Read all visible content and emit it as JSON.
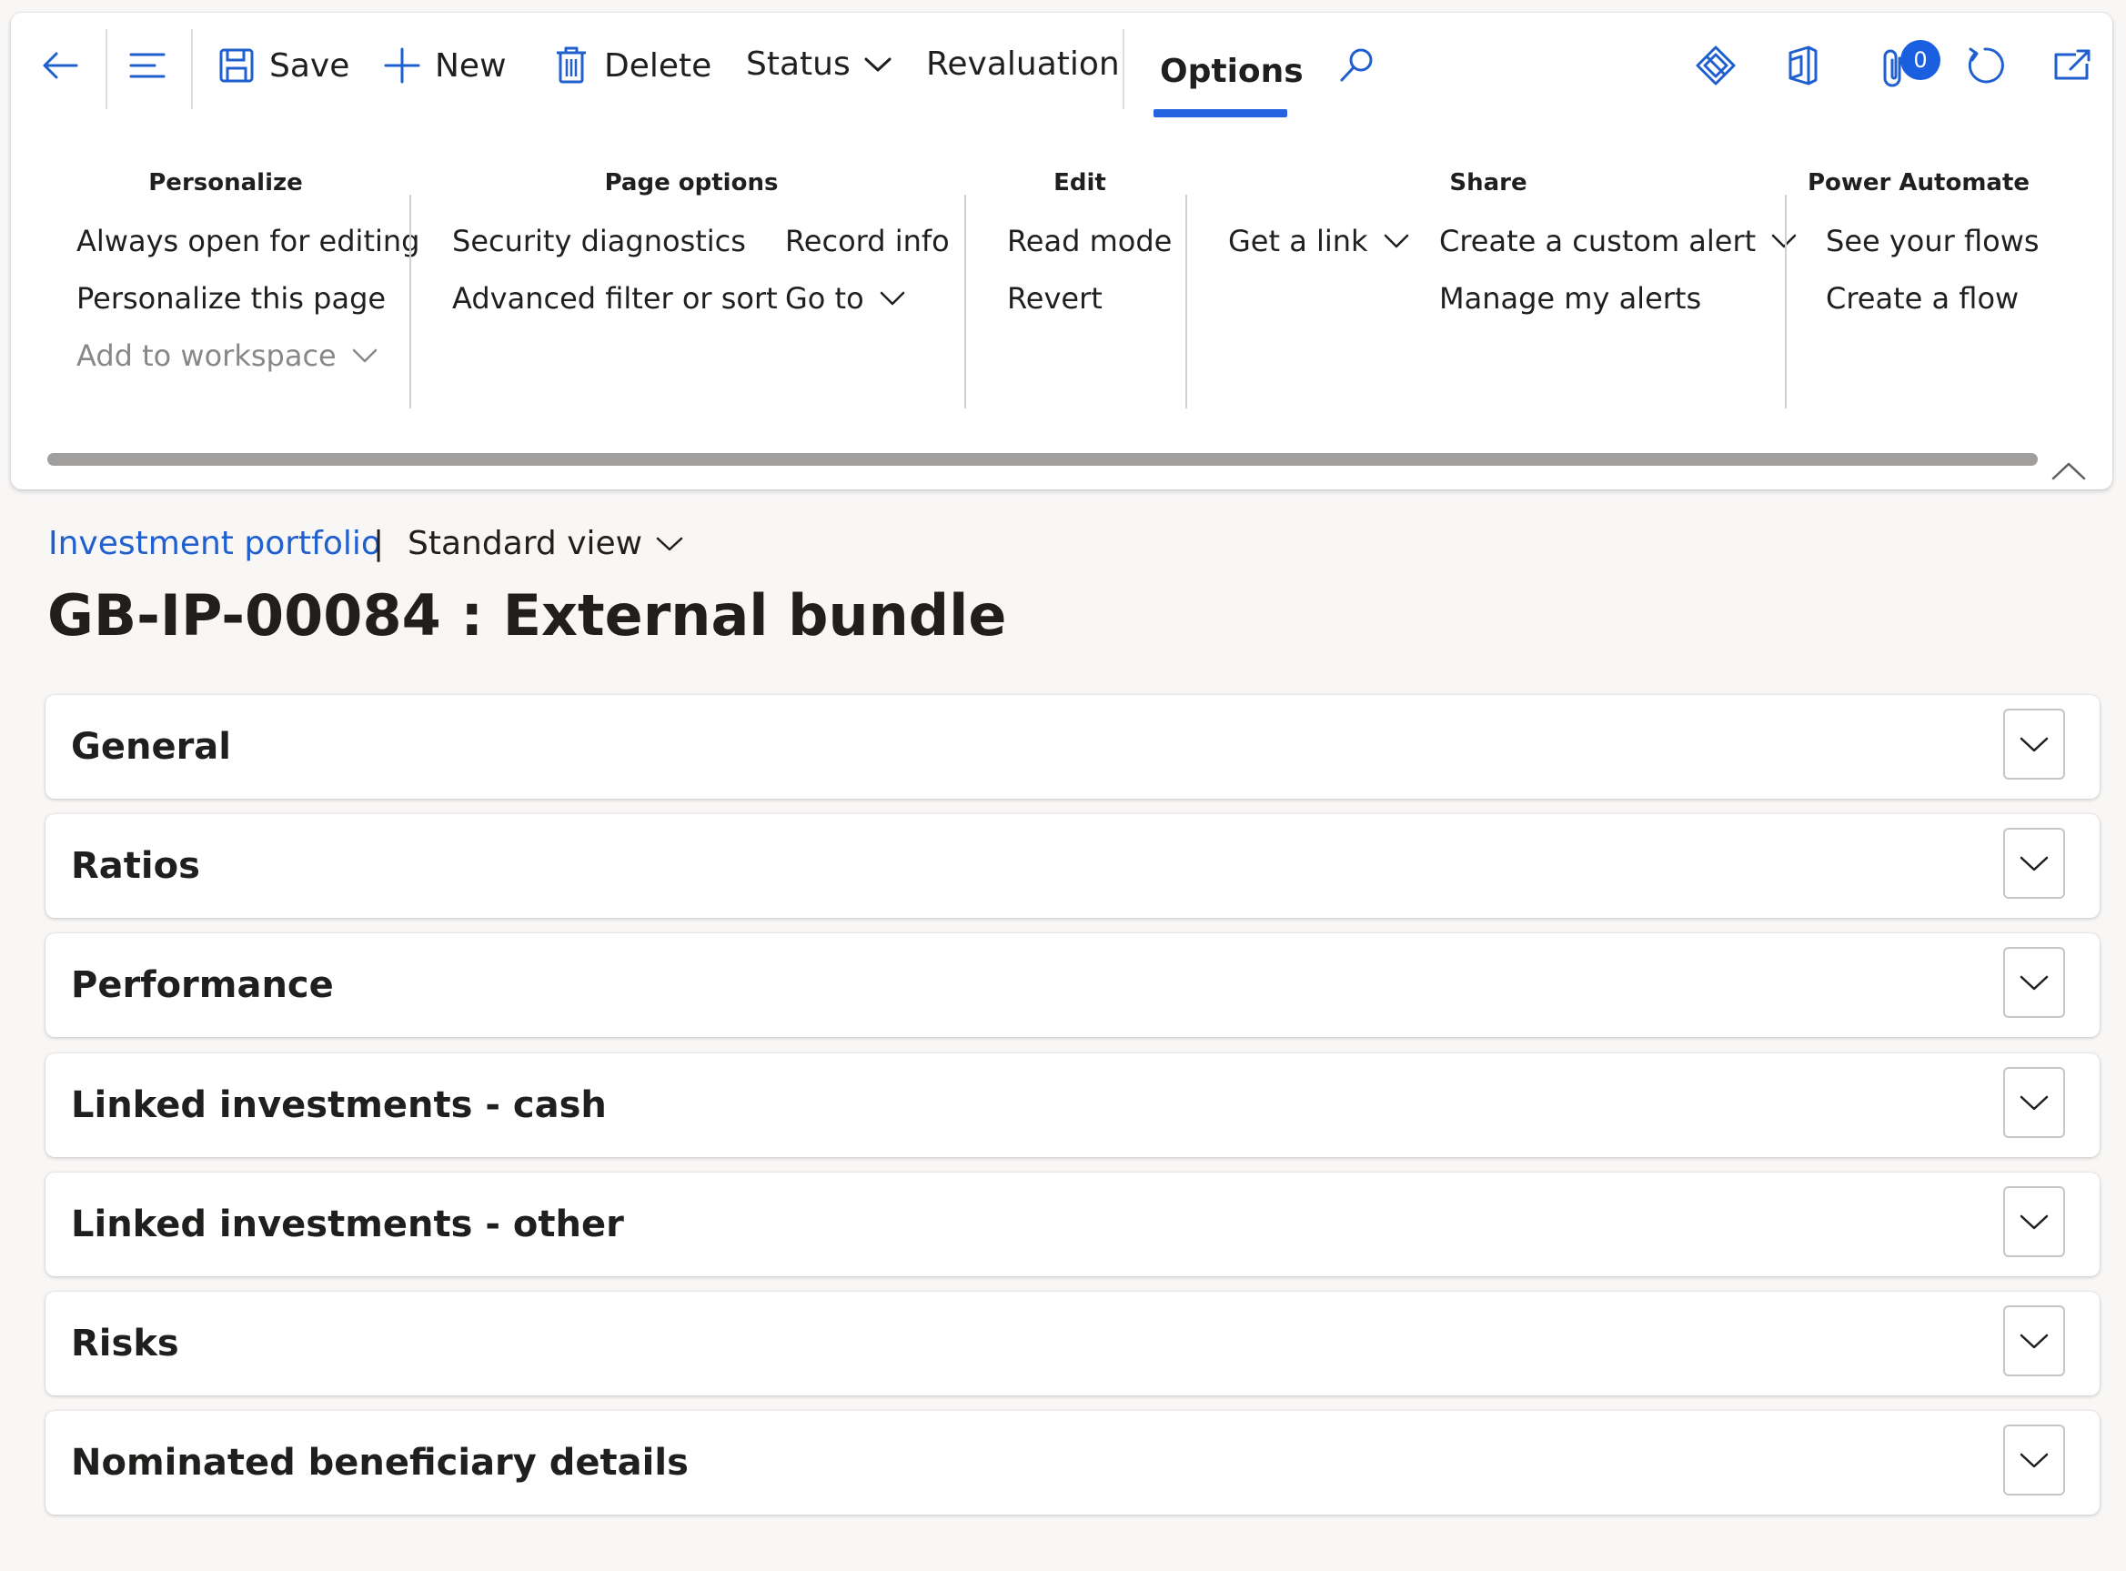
{
  "toolbar": {
    "save": "Save",
    "new": "New",
    "delete": "Delete",
    "status": "Status",
    "revaluation": "Revaluation",
    "options": "Options",
    "attachments_count": "0"
  },
  "ribbon": {
    "groups": {
      "personalize": {
        "title": "Personalize",
        "items": [
          "Always open for editing",
          "Personalize this page",
          "Add to workspace"
        ]
      },
      "page_options": {
        "title": "Page options",
        "items": [
          "Security diagnostics",
          "Advanced filter or sort",
          "Record info",
          "Go to"
        ]
      },
      "edit": {
        "title": "Edit",
        "items": [
          "Read mode",
          "Revert"
        ]
      },
      "share": {
        "title": "Share",
        "items": [
          "Get a link",
          "Create a custom alert",
          "Manage my alerts"
        ]
      },
      "power_automate": {
        "title": "Power Automate",
        "items": [
          "See your flows",
          "Create a flow"
        ]
      }
    }
  },
  "page": {
    "breadcrumb": "Investment portfolio",
    "separator": "|",
    "view": "Standard view",
    "title": "GB-IP-00084 : External bundle"
  },
  "sections": [
    "General",
    "Ratios",
    "Performance",
    "Linked investments - cash",
    "Linked investments - other",
    "Risks",
    "Nominated beneficiary details"
  ],
  "colors": {
    "accent": "#2563e0",
    "link": "#1f5fce",
    "badge": "#1a5fe0"
  }
}
